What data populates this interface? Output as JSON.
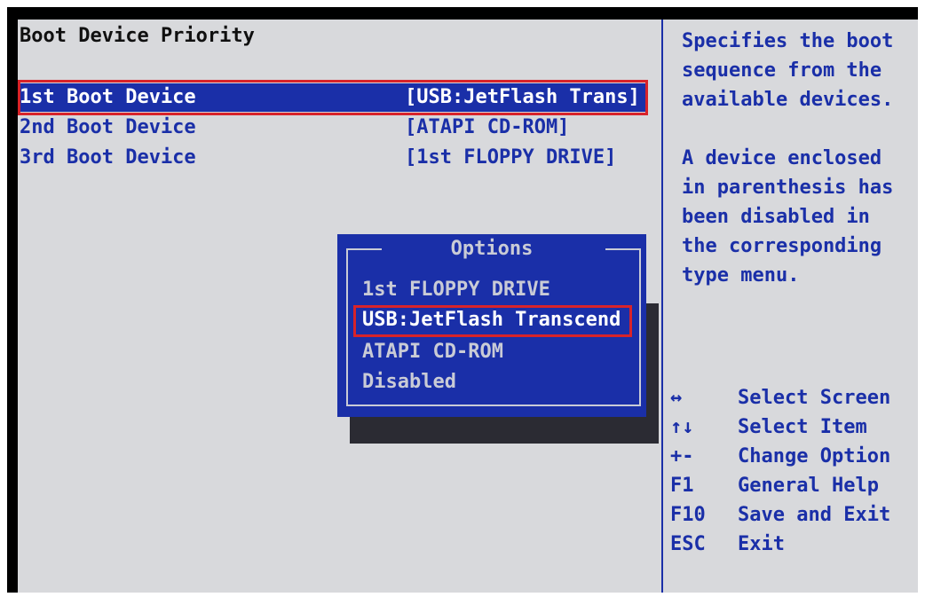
{
  "window": {
    "title": "Boot Device Priority"
  },
  "boot_devices": [
    {
      "label": "1st Boot Device",
      "value": "[USB:JetFlash Trans]",
      "selected": true
    },
    {
      "label": "2nd Boot Device",
      "value": "[ATAPI CD-ROM]",
      "selected": false
    },
    {
      "label": "3rd Boot Device",
      "value": "[1st FLOPPY DRIVE]",
      "selected": false
    }
  ],
  "help": {
    "paragraph1": "Specifies the boot sequence from the available devices.",
    "paragraph2": "A device enclosed in parenthesis has been disabled in the corresponding type menu."
  },
  "options_popup": {
    "title": "Options",
    "items": [
      {
        "label": "1st FLOPPY DRIVE",
        "active": false
      },
      {
        "label": "USB:JetFlash Transcend",
        "active": true
      },
      {
        "label": "ATAPI CD-ROM",
        "active": false
      },
      {
        "label": "Disabled",
        "active": false
      }
    ]
  },
  "key_legend": [
    {
      "key": "↔",
      "desc": "Select Screen"
    },
    {
      "key": "↑↓",
      "desc": "Select Item"
    },
    {
      "key": "+-",
      "desc": "Change Option"
    },
    {
      "key": "F1",
      "desc": "General Help"
    },
    {
      "key": "F10",
      "desc": "Save and Exit"
    },
    {
      "key": "ESC",
      "desc": "Exit"
    }
  ],
  "colors": {
    "background": "#d8d9dc",
    "accent": "#1a2fa8",
    "highlight_box": "#d8232a",
    "popup_text": "#c9cbd6"
  }
}
